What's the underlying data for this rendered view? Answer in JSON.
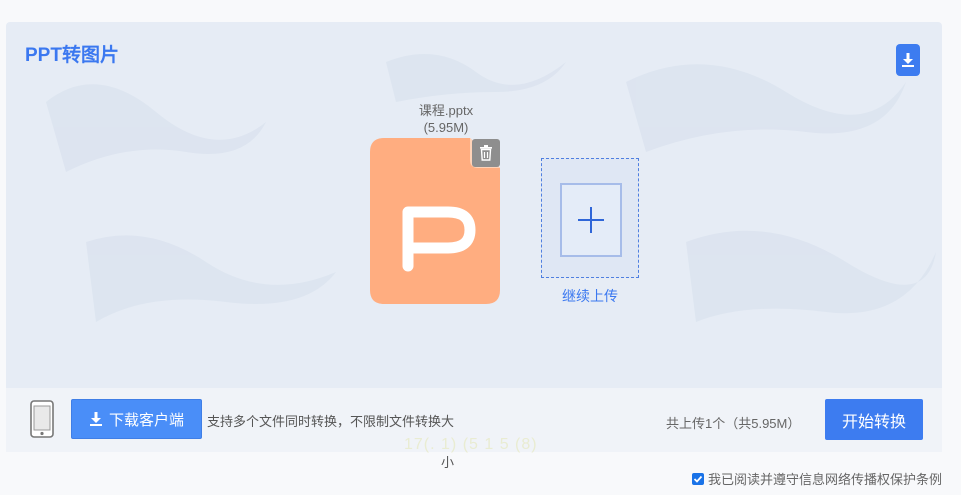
{
  "header": {
    "title": "PPT转图片",
    "download_icon": "download-icon"
  },
  "file": {
    "name": "课程.pptx",
    "size": "(5.95M)",
    "icon": "ppt-file-icon",
    "color": "#ffad80"
  },
  "upload_more": {
    "label": "继续上传",
    "icon": "plus-icon"
  },
  "footer": {
    "phone_icon": "mobile-phone-icon",
    "download_client_label": "下载客户端",
    "support_text_line1": "支持多个文件同时转换，不限制文件转换大",
    "support_text_line2": "小",
    "ghost_text": "17(. 1) (5 1 5 (8)",
    "upload_count": "共上传1个（共5.95M）",
    "start_label": "开始转换"
  },
  "agreement": {
    "checked": true,
    "text": "我已阅读并遵守信息网络传播权保护条例"
  },
  "colors": {
    "accent": "#3d7cf0",
    "panel_bg": "#e6ecf5",
    "file_orange": "#ffad80"
  }
}
